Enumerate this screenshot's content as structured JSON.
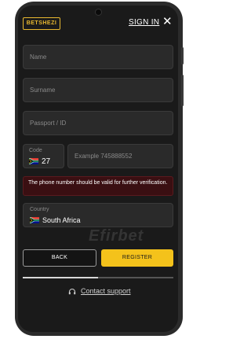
{
  "header": {
    "logo_text": "BETSHEZI",
    "signin_label": "SIGN IN",
    "close_symbol": "✕"
  },
  "form": {
    "name_placeholder": "Name",
    "surname_placeholder": "Surname",
    "passport_placeholder": "Passport / ID",
    "code_label": "Code",
    "code_value": "27",
    "phone_placeholder": "Example 745888552",
    "error_message": "The phone number should be valid for further verification.",
    "country_label": "Country",
    "country_value": "South Africa"
  },
  "actions": {
    "back_label": "BACK",
    "register_label": "REGISTER"
  },
  "footer": {
    "support_label": "Contact support",
    "support_icon": "headset-icon"
  },
  "watermark": "Efirbet",
  "colors": {
    "accent": "#f4c21b",
    "background": "#1a1a1a",
    "error_bg": "#3a0f12"
  }
}
